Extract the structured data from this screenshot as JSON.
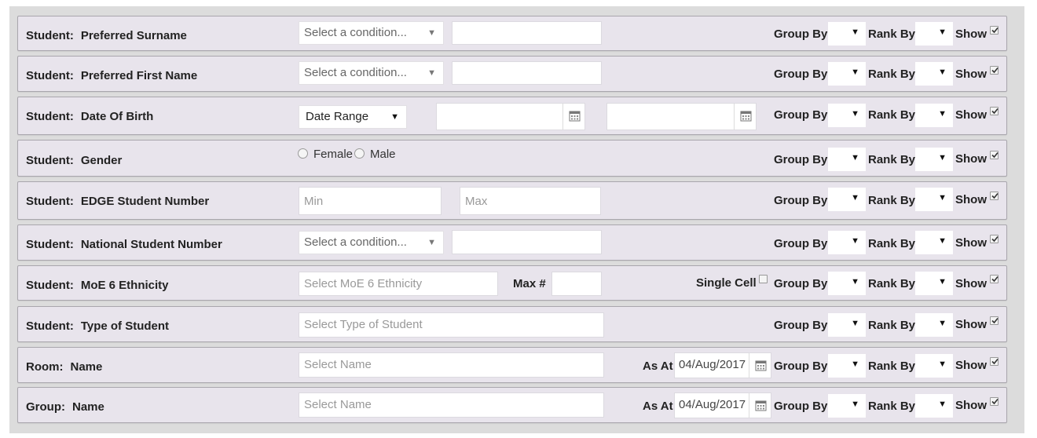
{
  "common": {
    "group_by": "Group By",
    "rank_by": "Rank By",
    "show": "Show",
    "select_condition": "Select a condition...",
    "dropdown_arrow": "▼",
    "calendar_icon": "calendar-icon"
  },
  "rows": [
    {
      "entity": "Student:",
      "field": "Preferred Surname",
      "control": "condition"
    },
    {
      "entity": "Student:",
      "field": "Preferred First Name",
      "control": "condition"
    },
    {
      "entity": "Student:",
      "field": "Date Of Birth",
      "control": "daterange",
      "range_value": "Date Range"
    },
    {
      "entity": "Student:",
      "field": "Gender",
      "control": "radio",
      "options": [
        "Female",
        "Male"
      ]
    },
    {
      "entity": "Student:",
      "field": "EDGE Student Number",
      "control": "minmax",
      "min_placeholder": "Min",
      "max_placeholder": "Max"
    },
    {
      "entity": "Student:",
      "field": "National Student Number",
      "control": "condition"
    },
    {
      "entity": "Student:",
      "field": "MoE 6 Ethnicity",
      "control": "ethnicity",
      "placeholder": "Select MoE 6 Ethnicity",
      "max_label": "Max #",
      "single_cell_label": "Single Cell"
    },
    {
      "entity": "Student:",
      "field": "Type of Student",
      "control": "select",
      "placeholder": "Select Type of Student"
    },
    {
      "entity": "Room:",
      "field": "Name",
      "control": "asat",
      "placeholder": "Select Name",
      "as_at_label": "As At",
      "date": "04/Aug/2017"
    },
    {
      "entity": "Group:",
      "field": "Name",
      "control": "asat",
      "placeholder": "Select Name",
      "as_at_label": "As At",
      "date": "04/Aug/2017"
    }
  ]
}
